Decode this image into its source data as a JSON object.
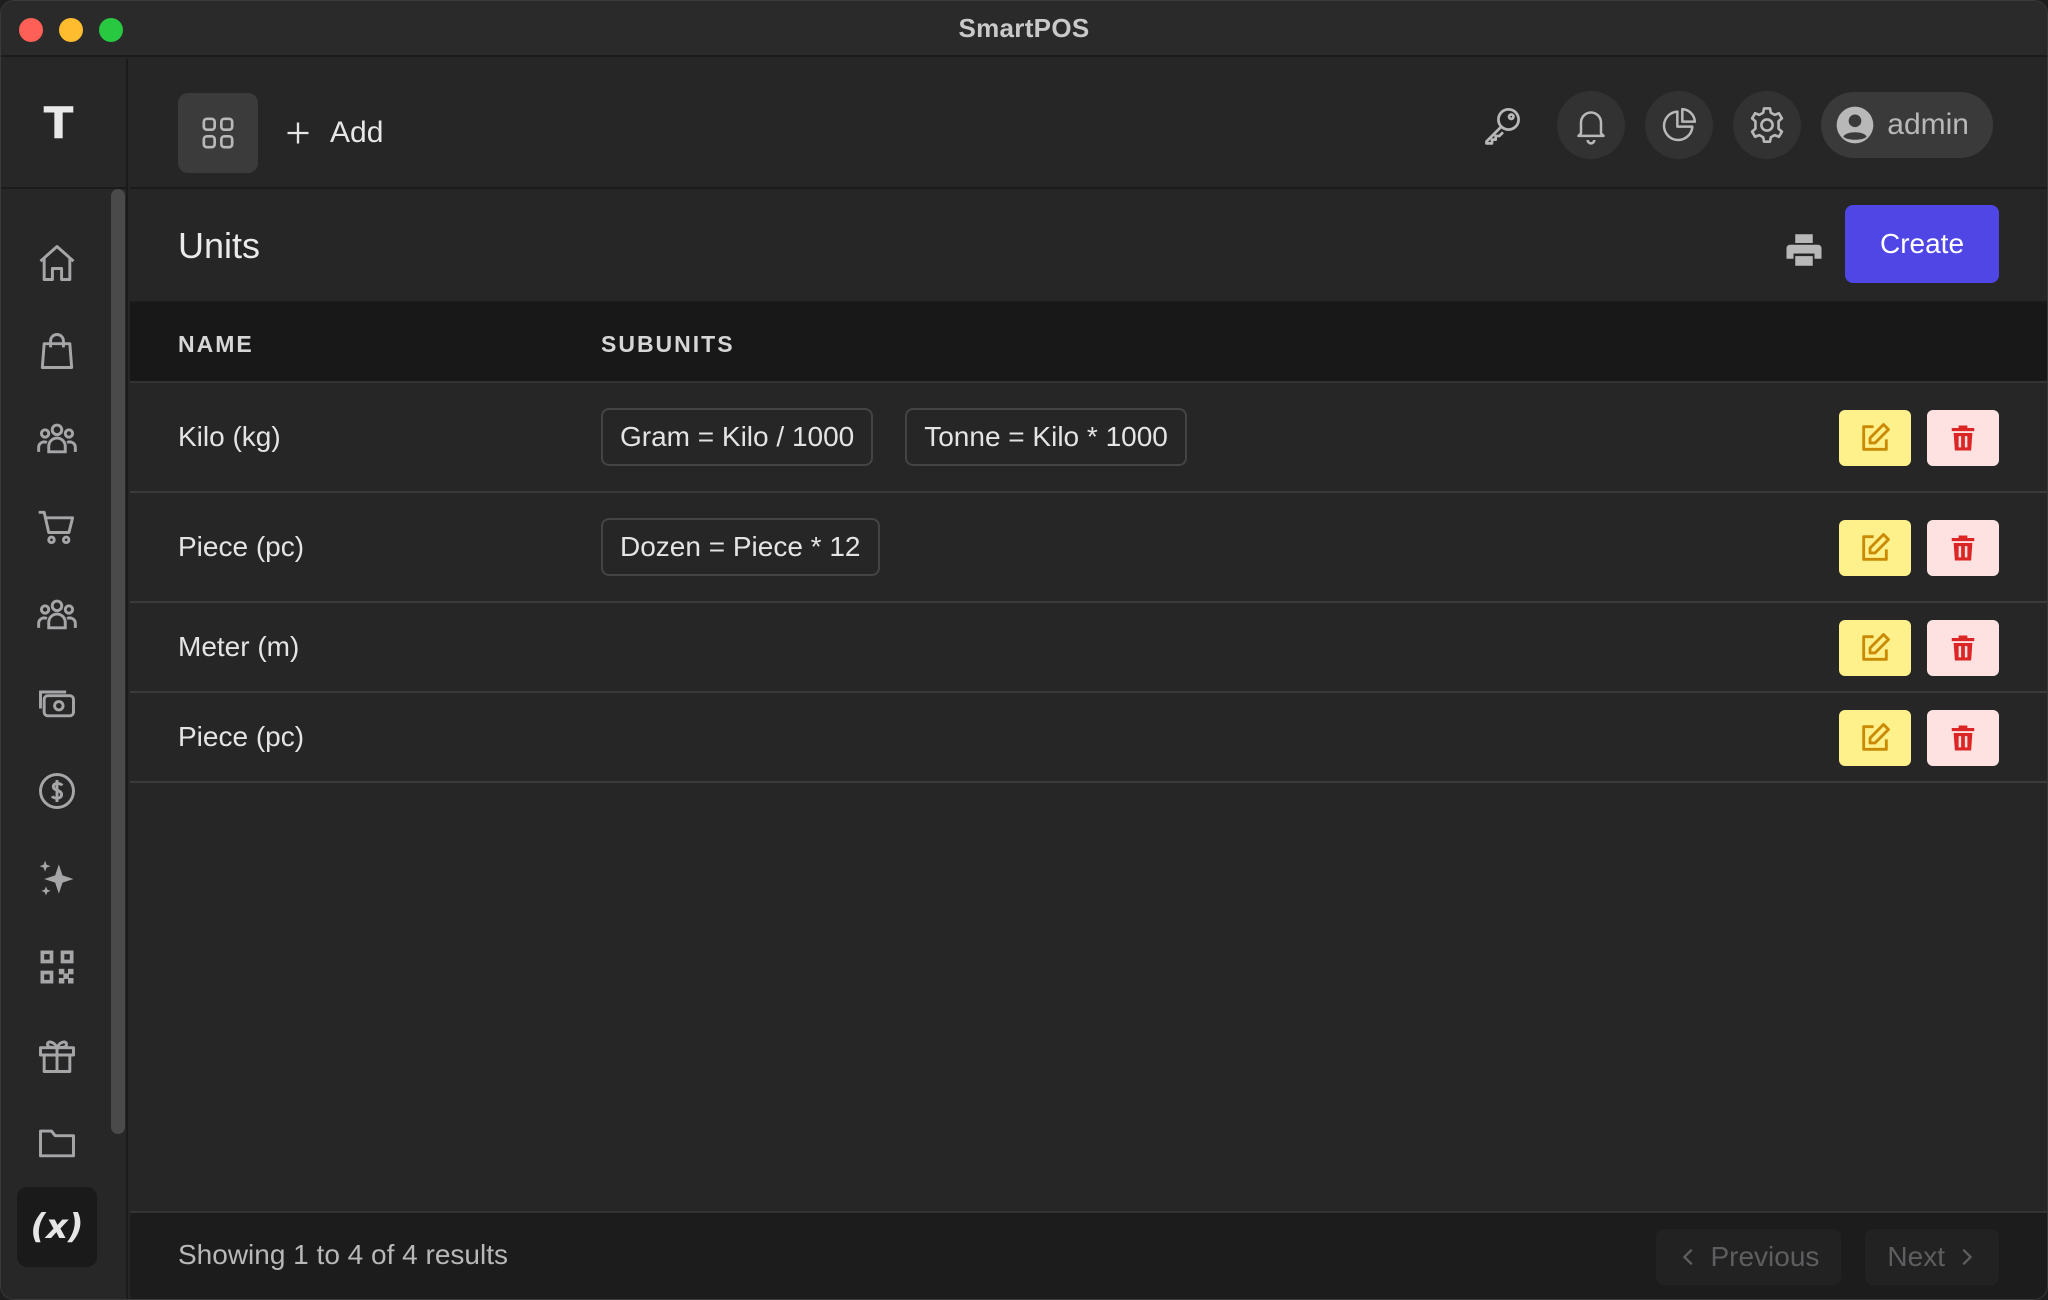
{
  "window": {
    "title": "SmartPOS"
  },
  "sidebar": {
    "logo": "T",
    "items": [
      {
        "icon": "home-icon"
      },
      {
        "icon": "shopping-bag-icon"
      },
      {
        "icon": "users-group-icon"
      },
      {
        "icon": "cart-icon"
      },
      {
        "icon": "customers-group-icon"
      },
      {
        "icon": "cash-icon"
      },
      {
        "icon": "dollar-icon"
      },
      {
        "icon": "sparkles-icon"
      },
      {
        "icon": "qr-code-icon"
      },
      {
        "icon": "gift-icon"
      },
      {
        "icon": "folder-icon"
      }
    ],
    "active_item": {
      "label": "(x)"
    }
  },
  "topbar": {
    "add_label": "Add",
    "user": "admin"
  },
  "page": {
    "title": "Units",
    "create_label": "Create"
  },
  "table": {
    "headers": {
      "name": "NAME",
      "subunits": "SUBUNITS"
    },
    "rows": [
      {
        "name": "Kilo (kg)",
        "subunits": [
          "Gram = Kilo / 1000",
          "Tonne = Kilo * 1000"
        ]
      },
      {
        "name": "Piece (pc)",
        "subunits": [
          "Dozen = Piece * 12"
        ]
      },
      {
        "name": "Meter (m)",
        "subunits": []
      },
      {
        "name": "Piece (pc)",
        "subunits": []
      }
    ]
  },
  "footer": {
    "summary": "Showing 1 to 4 of 4 results",
    "previous": "Previous",
    "next": "Next"
  },
  "colors": {
    "accent": "#4f46e5",
    "edit_bg": "#fef08a",
    "edit_fg": "#ca8a04",
    "delete_bg": "#fee2e2",
    "delete_fg": "#dc2626"
  }
}
